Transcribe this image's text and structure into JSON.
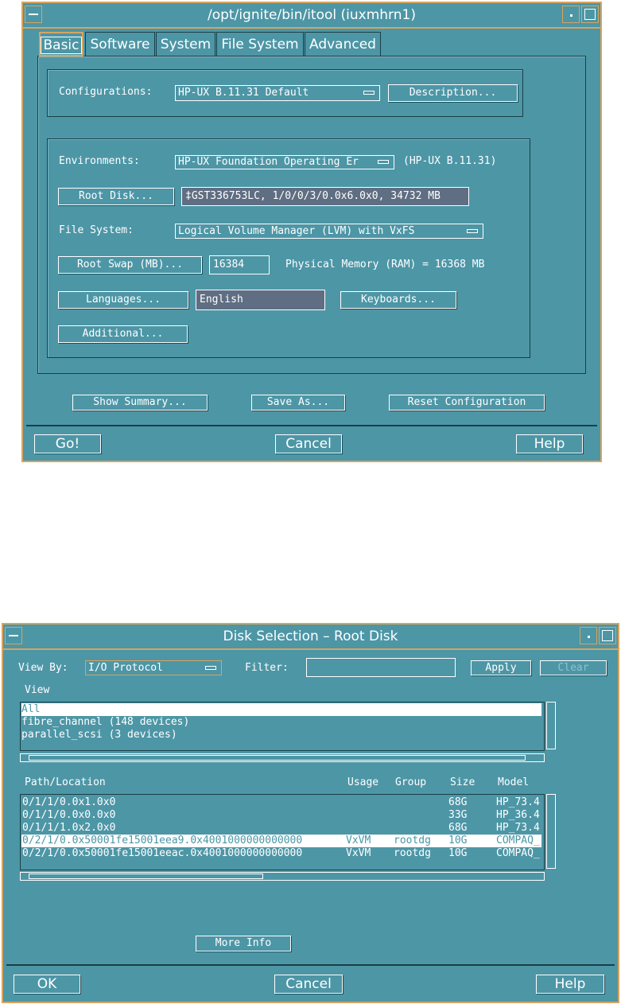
{
  "top_window": {
    "title": "/opt/ignite/bin/itool (iuxmhrn1)",
    "tabs": [
      "Basic",
      "Software",
      "System",
      "File System",
      "Advanced"
    ],
    "configurations_label": "Configurations:",
    "configurations_value": "HP-UX B.11.31 Default",
    "description_button": "Description...",
    "environments_label": "Environments:",
    "environments_value": "HP-UX Foundation Operating Er",
    "environments_note": "(HP-UX B.11.31)",
    "root_disk_button": "Root Disk...",
    "root_disk_value": "‡GST336753LC, 1/0/0/3/0.0x6.0x0, 34732 MB",
    "file_system_label": "File System:",
    "file_system_value": "Logical Volume Manager (LVM) with VxFS",
    "root_swap_button": "Root Swap (MB)...",
    "root_swap_value": "16384",
    "physical_memory": "Physical Memory (RAM) =  16368 MB",
    "languages_button": "Languages...",
    "languages_value": "English",
    "keyboards_button": "Keyboards...",
    "additional_button": "Additional...",
    "show_summary_button": "Show Summary...",
    "save_as_button": "Save As...",
    "reset_button": "Reset Configuration",
    "go_button": "Go!",
    "cancel_button": "Cancel",
    "help_button": "Help"
  },
  "bottom_window": {
    "title": "Disk Selection – Root Disk",
    "view_by_label": "View By:",
    "view_by_value": "I/O Protocol",
    "filter_label": "Filter:",
    "filter_value": "",
    "apply_button": "Apply",
    "clear_button": "Clear",
    "view_label": "View",
    "view_items": [
      "All",
      "fibre_channel  (148 devices)",
      "parallel_scsi  (3 devices)"
    ],
    "columns": [
      "Path/Location",
      "Usage",
      "Group",
      "Size",
      "Model"
    ],
    "rows": [
      {
        "path": "0/1/1/0.0x1.0x0",
        "usage": "",
        "group": "",
        "size": "68G",
        "model": "HP_73.4"
      },
      {
        "path": "0/1/1/0.0x0.0x0",
        "usage": "",
        "group": "",
        "size": "33G",
        "model": "HP_36.4"
      },
      {
        "path": "0/1/1/1.0x2.0x0",
        "usage": "",
        "group": "",
        "size": "68G",
        "model": "HP_73.4"
      },
      {
        "path": "0/2/1/0.0x50001fe15001eea9.0x4001000000000000",
        "usage": "VxVM",
        "group": "rootdg",
        "size": "10G",
        "model": "COMPAQ_"
      },
      {
        "path": "0/2/1/0.0x50001fe15001eeac.0x4001000000000000",
        "usage": "VxVM",
        "group": "rootdg",
        "size": "10G",
        "model": "COMPAQ_"
      }
    ],
    "selected_row": 3,
    "more_info_button": "More Info",
    "ok_button": "OK",
    "cancel_button": "Cancel",
    "help_button": "Help"
  },
  "colors": {
    "window_bg": "#4d96a6",
    "border": "#d7a45f",
    "text": "#ffffff",
    "field_bg": "#5f6e82"
  }
}
